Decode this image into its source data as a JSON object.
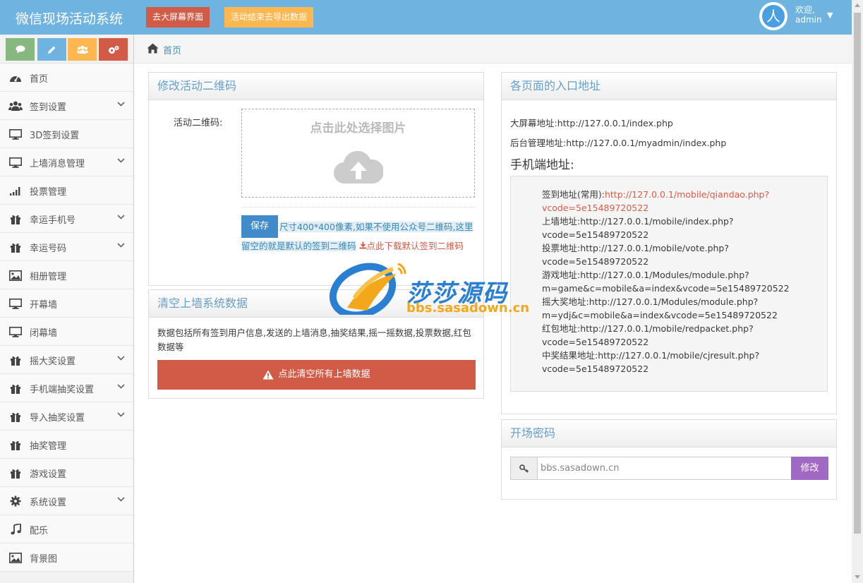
{
  "app": {
    "title": "微信现场活动系统"
  },
  "navbar": {
    "big_screen_button": "去大屏幕界面",
    "export_button": "活动结束去导出数据",
    "user": {
      "greeting": "欢迎,",
      "name": "admin"
    }
  },
  "sidebar": {
    "shortcuts": [
      {
        "icon": "comments-icon",
        "color": "#87b87f"
      },
      {
        "icon": "pencil-icon",
        "color": "#6fb3e0"
      },
      {
        "icon": "group-icon",
        "color": "#ffb752"
      },
      {
        "icon": "cogs-icon",
        "color": "#d15b47"
      }
    ],
    "items": [
      {
        "label": "首页",
        "icon": "dashboard-icon",
        "has_submenu": false
      },
      {
        "label": "签到设置",
        "icon": "users-icon",
        "has_submenu": true
      },
      {
        "label": "3D签到设置",
        "icon": "desktop-icon",
        "has_submenu": false
      },
      {
        "label": "上墙消息管理",
        "icon": "desktop-icon",
        "has_submenu": true
      },
      {
        "label": "投票管理",
        "icon": "signal-icon",
        "has_submenu": false
      },
      {
        "label": "幸运手机号",
        "icon": "gift-icon",
        "has_submenu": true
      },
      {
        "label": "幸运号码",
        "icon": "gift-icon",
        "has_submenu": true
      },
      {
        "label": "相册管理",
        "icon": "picture-icon",
        "has_submenu": false
      },
      {
        "label": "开幕墙",
        "icon": "desktop-icon",
        "has_submenu": false
      },
      {
        "label": "闭幕墙",
        "icon": "desktop-icon",
        "has_submenu": false
      },
      {
        "label": "摇大奖设置",
        "icon": "gift-icon",
        "has_submenu": true
      },
      {
        "label": "手机端抽奖设置",
        "icon": "gift-icon",
        "has_submenu": true
      },
      {
        "label": "导入抽奖设置",
        "icon": "gift-icon",
        "has_submenu": true
      },
      {
        "label": "抽奖管理",
        "icon": "gift-icon",
        "has_submenu": false
      },
      {
        "label": "游戏设置",
        "icon": "gift-icon",
        "has_submenu": false
      },
      {
        "label": "系统设置",
        "icon": "gear-icon",
        "has_submenu": true
      },
      {
        "label": "配乐",
        "icon": "music-icon",
        "has_submenu": false
      },
      {
        "label": "背景图",
        "icon": "picture-icon",
        "has_submenu": false
      }
    ]
  },
  "breadcrumb": {
    "home": "首页"
  },
  "qr_panel": {
    "title": "修改活动二维码",
    "field_label": "活动二维码:",
    "upload_text": "点击此处选择图片",
    "save_button": "保存",
    "hint": "尺寸400*400像素,如果不使用公众号二维码,这里留空的就是默认的签到二维码",
    "download_link": "点此下载默认签到二维码"
  },
  "clear_panel": {
    "title": "清空上墙系统数据",
    "description": "数据包括所有签到用户信息,发送的上墙消息,抽奖结果,摇一摇数据,投票数据,红包数据等",
    "button": "点此清空所有上墙数据"
  },
  "entry_panel": {
    "title": "各页面的入口地址",
    "big_screen": "大屏幕地址:http://127.0.0.1/index.php",
    "admin": "后台管理地址:http://127.0.0.1/myadmin/index.php",
    "mobile_title": "手机端地址:",
    "mobile": [
      {
        "label": "签到地址(常用):",
        "url": "http://127.0.0.1/mobile/qiandao.php?",
        "cont": "vcode=5e15489720522",
        "highlight": true
      },
      {
        "label": "上墙地址:",
        "url": "http://127.0.0.1/mobile/index.php?",
        "cont": "vcode=5e15489720522",
        "highlight": false
      },
      {
        "label": "投票地址:",
        "url": "http://127.0.0.1/mobile/vote.php?",
        "cont": "vcode=5e15489720522",
        "highlight": false
      },
      {
        "label": "游戏地址:",
        "url": "http://127.0.0.1/Modules/module.php?",
        "cont": "m=game&c=mobile&a=index&vcode=5e15489720522",
        "highlight": false
      },
      {
        "label": "摇大奖地址:",
        "url": "http://127.0.0.1/Modules/module.php?",
        "cont": "m=ydj&c=mobile&a=index&vcode=5e15489720522",
        "highlight": false
      },
      {
        "label": "红包地址:",
        "url": "http://127.0.0.1/mobile/redpacket.php?",
        "cont": "vcode=5e15489720522",
        "highlight": false
      },
      {
        "label": "中奖结果地址:",
        "url": "http://127.0.0.1/mobile/cjresult.php?",
        "cont": "vcode=5e15489720522",
        "highlight": false
      }
    ]
  },
  "password_panel": {
    "title": "开场密码",
    "value": "bbs.sasadown.cn",
    "button": "修改"
  },
  "watermark": {
    "title": "莎莎源码",
    "url": "bbs.sasadown.cn"
  },
  "colors": {
    "navbar": "#6fb3e0",
    "danger": "#d15b47",
    "warning": "#ffb752",
    "primary": "#428bca",
    "purple": "#a069c3"
  }
}
